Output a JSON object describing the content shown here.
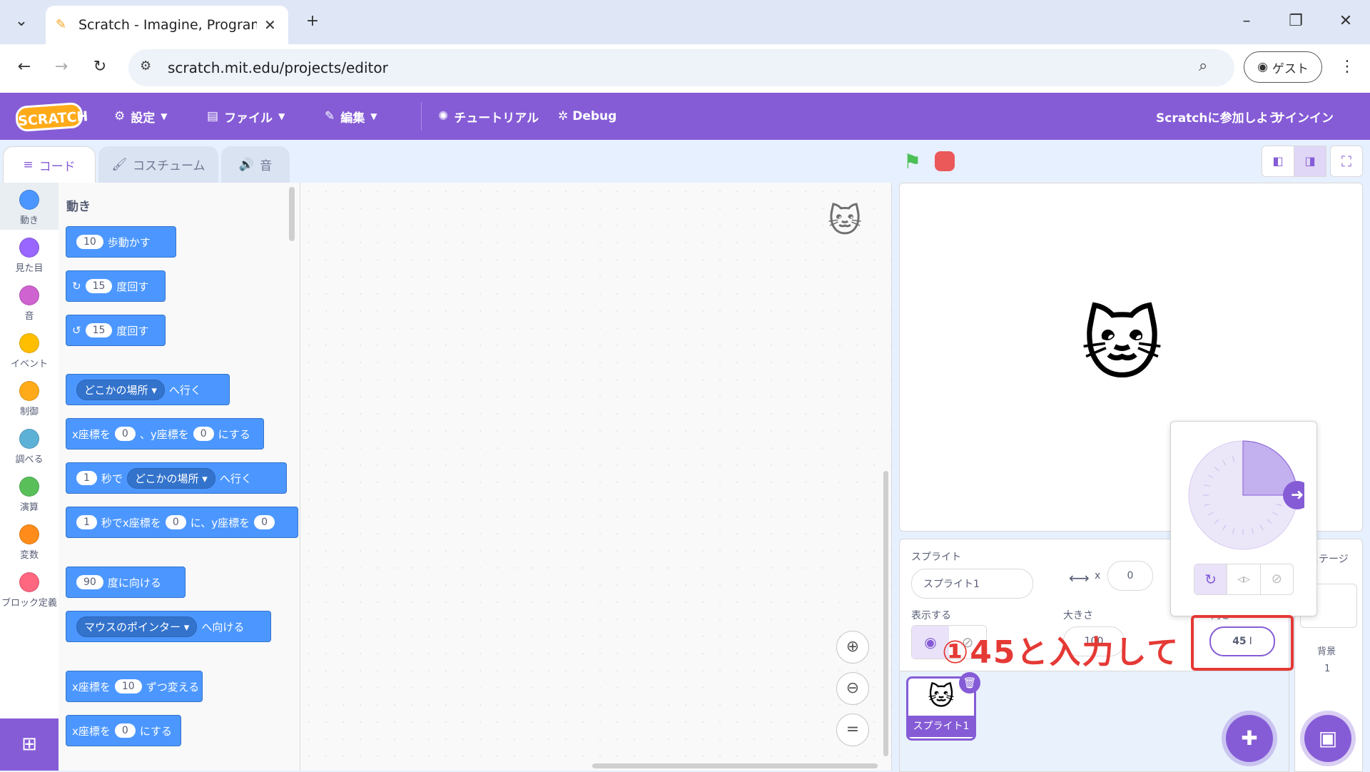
{
  "browser": {
    "tab_title": "Scratch - Imagine, Program, Sha",
    "url": "scratch.mit.edu/projects/editor",
    "guest_label": "ゲスト"
  },
  "menubar": {
    "logo": "SCRATCH",
    "settings": "設定",
    "file": "ファイル",
    "edit": "編集",
    "tutorials": "チュートリアル",
    "debug": "Debug",
    "join": "Scratchに参加しよう",
    "signin": "サインイン"
  },
  "editor_tabs": {
    "code": "コード",
    "costumes": "コスチューム",
    "sounds": "音"
  },
  "categories": [
    {
      "label": "動き",
      "color": "#4c97ff"
    },
    {
      "label": "見た目",
      "color": "#9966ff"
    },
    {
      "label": "音",
      "color": "#cf63cf"
    },
    {
      "label": "イベント",
      "color": "#ffbf00"
    },
    {
      "label": "制御",
      "color": "#ffab19"
    },
    {
      "label": "調べる",
      "color": "#5cb1d6"
    },
    {
      "label": "演算",
      "color": "#59c059"
    },
    {
      "label": "変数",
      "color": "#ff8c1a"
    },
    {
      "label": "ブロック定義",
      "color": "#ff6680"
    }
  ],
  "palette": {
    "heading": "動き",
    "b1": {
      "v": "10",
      "t": "歩動かす"
    },
    "b2": {
      "v": "15",
      "t": "度回す"
    },
    "b3": {
      "v": "15",
      "t": "度回す"
    },
    "b4": {
      "d": "どこかの場所",
      "t": "へ行く"
    },
    "b5": {
      "t1": "x座標を",
      "v1": "0",
      "t2": "、y座標を",
      "v2": "0",
      "t3": "にする"
    },
    "b6": {
      "v": "1",
      "t1": "秒で",
      "d": "どこかの場所",
      "t2": "へ行く"
    },
    "b7": {
      "v1": "1",
      "t1": "秒でx座標を",
      "v2": "0",
      "t2": "に、y座標を",
      "v3": "0"
    },
    "b8": {
      "v": "90",
      "t": "度に向ける"
    },
    "b9": {
      "d": "マウスのポインター",
      "t": "へ向ける"
    },
    "b10": {
      "t1": "x座標を",
      "v": "10",
      "t2": "ずつ変える"
    },
    "b11": {
      "t1": "x座標を",
      "v": "0",
      "t2": "にする"
    }
  },
  "sprite_info": {
    "sprite_label": "スプライト",
    "sprite_name": "スプライト1",
    "x_label": "x",
    "x_value": "0",
    "show_label": "表示する",
    "size_label": "大きさ",
    "size_value": "100",
    "direction_label": "向き",
    "direction_value": "45"
  },
  "sprite_list": {
    "sprite1": "スプライト1"
  },
  "stage_panel": {
    "title": "ステージ",
    "backdrop_label": "背景",
    "backdrop_count": "1"
  },
  "annotation": {
    "text": "①45と入力して"
  },
  "direction_dial": {
    "angle_deg": 45
  }
}
